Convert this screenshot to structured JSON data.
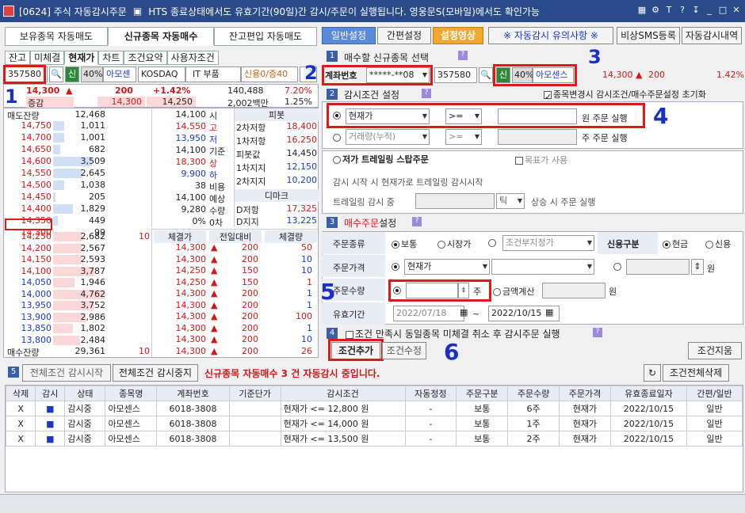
{
  "title": {
    "code": "[0624] 주식 자동감시주문",
    "notice": "HTS 종료상태에서도 유효기간(90일)간 감시/주문이 실행됩니다. 영웅문S(모바일)에서도 확인가능"
  },
  "tabs": [
    "보유종목 자동매도",
    "신규종목 자동매수",
    "잔고편입 자동매도"
  ],
  "topbtns": {
    "general": "일반설정",
    "simple": "간편설정",
    "video": "설정영상",
    "notice": "※ 자동감시 유의사항 ※",
    "sms": "비상SMS등록",
    "history": "자동감시내역"
  },
  "subtabs": [
    "잔고",
    "미체결",
    "현재가",
    "차트",
    "조건요약",
    "사용자조건"
  ],
  "stock": {
    "code": "357580",
    "credit": "신",
    "ratio": "40%",
    "name": "아모센스",
    "market": "KOSDAQ",
    "sector": "IT 부품",
    "loan": "신용0/증40"
  },
  "quote": {
    "price": "14,300",
    "change": "200",
    "pct": "+1.42%",
    "vol": "140,488",
    "vp": "7.20%",
    "vp2": "1.25%",
    "label": "증감",
    "sp1": "14,300",
    "sp2": "14,250",
    "amt": "2,002백만"
  },
  "left": {
    "sell_label": "매도잔량",
    "buy_label": "매수잔량",
    "sell_total": "12,468",
    "buy_total": "29,361",
    "buy_total2": "10",
    "asks": [
      {
        "p": "14,750",
        "q": "1,011"
      },
      {
        "p": "14,700",
        "q": "1,001"
      },
      {
        "p": "14,650",
        "q": "682"
      },
      {
        "p": "14,600",
        "q": "3,509"
      },
      {
        "p": "14,550",
        "q": "2,645"
      },
      {
        "p": "14,500",
        "q": "1,038"
      },
      {
        "p": "14,450",
        "q": "205"
      },
      {
        "p": "14,400",
        "q": "1,829"
      },
      {
        "p": "14,350",
        "q": "449"
      },
      {
        "p": "14,300",
        "q": "99"
      }
    ],
    "bids": [
      {
        "p": "14,250",
        "q": "2,682",
        "x": "10"
      },
      {
        "p": "14,200",
        "q": "2,567",
        "x": ""
      },
      {
        "p": "14,150",
        "q": "2,593",
        "x": ""
      },
      {
        "p": "14,100",
        "q": "3,787",
        "x": ""
      },
      {
        "p": "14,050",
        "q": "1,946",
        "x": ""
      },
      {
        "p": "14,000",
        "q": "4,762",
        "x": ""
      },
      {
        "p": "13,950",
        "q": "3,752",
        "x": ""
      },
      {
        "p": "13,900",
        "q": "2,986",
        "x": ""
      },
      {
        "p": "13,850",
        "q": "1,802",
        "x": ""
      },
      {
        "p": "13,800",
        "q": "2,484",
        "x": ""
      }
    ]
  },
  "info": [
    {
      "v": "14,100",
      "l": "시"
    },
    {
      "v": "14,550",
      "l": "고"
    },
    {
      "v": "13,950",
      "l": "저"
    },
    {
      "v": "14,100",
      "l": "기준"
    },
    {
      "v": "18,300",
      "l": "상"
    },
    {
      "v": "9,900",
      "l": "하"
    },
    {
      "v": "38",
      "l": "비용"
    },
    {
      "v": "14,100",
      "l": "예상"
    },
    {
      "v": "9,280",
      "l": "수량"
    },
    {
      "v": "0%",
      "l": "0차"
    }
  ],
  "pivot": {
    "title": "피봇",
    "rows": [
      {
        "l": "2차저항",
        "v": "18,400"
      },
      {
        "l": "1차저항",
        "v": "16,250"
      },
      {
        "l": "피봇값",
        "v": "14,450"
      },
      {
        "l": "1차지지",
        "v": "12,150"
      },
      {
        "l": "2차지지",
        "v": "10,200"
      }
    ],
    "demark": "디마크",
    "drows": [
      {
        "l": "D저항",
        "v": "17,325"
      },
      {
        "l": "D지지",
        "v": "13,225"
      }
    ]
  },
  "trades": {
    "h": [
      "체결가",
      "전일대비",
      "체결량"
    ],
    "rows": [
      [
        "14,300",
        "200",
        "50"
      ],
      [
        "14,300",
        "200",
        "10"
      ],
      [
        "14,250",
        "150",
        "10"
      ],
      [
        "14,250",
        "150",
        "1"
      ],
      [
        "14,300",
        "200",
        "1"
      ],
      [
        "14,300",
        "200",
        "1"
      ],
      [
        "14,300",
        "200",
        "100"
      ],
      [
        "14,300",
        "200",
        "1"
      ],
      [
        "14,300",
        "200",
        "10"
      ],
      [
        "14,300",
        "200",
        "26"
      ]
    ]
  },
  "sec1": {
    "title": "매수할 신규종목 선택",
    "acct_label": "계좌번호",
    "acct": "*****-**08",
    "code": "357580",
    "credit": "신",
    "ratio": "40%",
    "name": "아모센스",
    "price": "14,300",
    "chg": "200",
    "pct": "1.42%"
  },
  "sec2": {
    "title": "감시조건 설정",
    "opt": "종목변경시 감시조건/매수주문설정 초기화",
    "c1": "현재가",
    "op1": ">=",
    "u1": "원 주문 실행",
    "c2": "거래량(누적)",
    "op2": ">=",
    "u2": "주 주문 실행",
    "trail": "저가 트레일링 스탑주문",
    "target": "목표가 사용",
    "t1": "감시 시작 시 현재가로 트레일링 감시시작",
    "t2": "트레일링 감시 중",
    "tick": "틱",
    "t3": "상승 시 주문 실행"
  },
  "sec3": {
    "title_a": "매수주문",
    "title_b": "설정",
    "otype": "주문종류",
    "o1": "보통",
    "o2": "시장가",
    "o3": "조건부지정가",
    "credit": "신용구분",
    "c1": "현금",
    "c2": "신용",
    "oprice": "주문가격",
    "pval": "현재가",
    "won": "원",
    "oqty": "주문수량",
    "ju": "주",
    "amt": "금액계산",
    "won2": "원",
    "period": "유효기간",
    "d1": "2022/07/18",
    "tilde": "~",
    "d2": "2022/10/15"
  },
  "sec4": {
    "title": "조건 만족시 동일종목 미체결 취소 후 감시주문 실행",
    "add": "조건추가",
    "mod": "조건수정",
    "del": "조건지움"
  },
  "sec5": {
    "start": "전체조건 감시시작",
    "stop": "전체조건 감시중지",
    "status": "신규종목 자동매수 3 건 자동감시 중입니다.",
    "clear": "조건전체삭제",
    "h": [
      "삭제",
      "감시",
      "상태",
      "종목명",
      "계좌번호",
      "기준단가",
      "감시조건",
      "자동정정",
      "주문구분",
      "주문수량",
      "주문가격",
      "유효종료일자",
      "간편/일반"
    ],
    "rows": [
      [
        "X",
        "■",
        "감시중",
        "아모센스",
        "6018-3808",
        "",
        "현재가 <= 12,800 원",
        "-",
        "보통",
        "6주",
        "현재가",
        "2022/10/15",
        "일반"
      ],
      [
        "X",
        "■",
        "감시중",
        "아모센스",
        "6018-3808",
        "",
        "현재가 <= 14,000 원",
        "-",
        "보통",
        "1주",
        "현재가",
        "2022/10/15",
        "일반"
      ],
      [
        "X",
        "■",
        "감시중",
        "아모센스",
        "6018-3808",
        "",
        "현재가 <= 13,500 원",
        "-",
        "보통",
        "2주",
        "현재가",
        "2022/10/15",
        "일반"
      ]
    ]
  },
  "marks": [
    "1",
    "2",
    "3",
    "4",
    "5",
    "6"
  ],
  "colors": {
    "title": "#2b4a8a",
    "up": "#d01818",
    "down": "#1838c8",
    "mark": "#e01818"
  }
}
